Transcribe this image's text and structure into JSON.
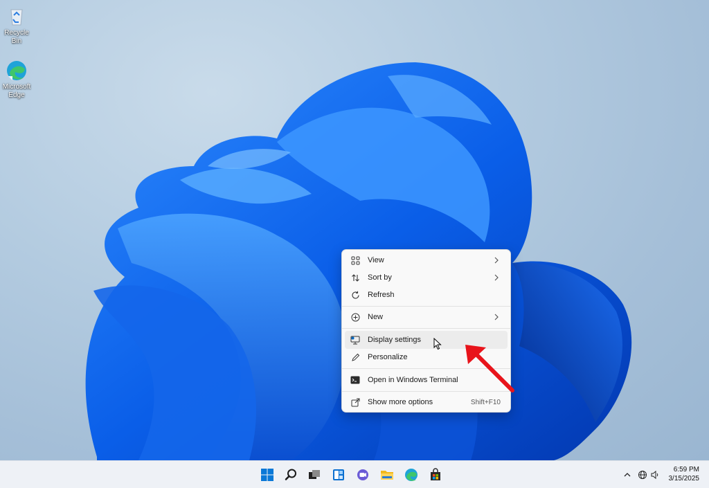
{
  "desktop_icons": [
    {
      "label": "Recycle Bin",
      "icon": "recycle-bin-icon"
    },
    {
      "label": "Microsoft Edge",
      "icon": "edge-icon"
    }
  ],
  "context_menu": {
    "items": [
      {
        "label": "View",
        "icon": "grid-icon",
        "submenu": true
      },
      {
        "label": "Sort by",
        "icon": "sort-icon",
        "submenu": true
      },
      {
        "label": "Refresh",
        "icon": "refresh-icon"
      },
      {
        "label": "New",
        "icon": "plus-circle-icon",
        "submenu": true
      },
      {
        "label": "Display settings",
        "icon": "display-icon",
        "highlighted": true
      },
      {
        "label": "Personalize",
        "icon": "pen-icon"
      },
      {
        "label": "Open in Windows Terminal",
        "icon": "terminal-icon"
      },
      {
        "label": "Show more options",
        "icon": "share-icon",
        "shortcut": "Shift+F10"
      }
    ]
  },
  "taskbar": {
    "apps": [
      "start-icon",
      "search-icon",
      "task-view-icon",
      "widgets-icon",
      "chat-icon",
      "file-explorer-icon",
      "edge-icon",
      "store-icon"
    ],
    "clock": {
      "time": "6:59 PM",
      "date": "3/15/2025"
    }
  },
  "colors": {
    "accent": "#0067c0",
    "annotation_arrow": "#e8141b"
  }
}
